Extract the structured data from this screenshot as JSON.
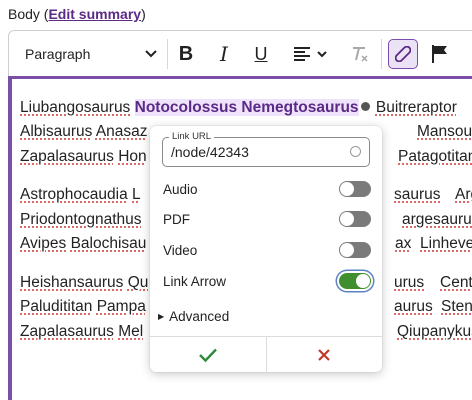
{
  "field": {
    "label": "Body (",
    "link": "Edit summary",
    "close": ")"
  },
  "toolbar": {
    "format_value": "Paragraph",
    "icons": [
      "chevron-down-icon",
      "bold-icon",
      "italic-icon",
      "underline-icon",
      "align-icon",
      "remove-format-icon",
      "link-icon",
      "flag-icon"
    ]
  },
  "editor": {
    "lines": [
      [
        "Liubangosaurus",
        "Notocolossus Nemegtosaurus",
        "Buitreraptor"
      ],
      [
        "Albisaurus",
        "Anasaz",
        "Mansourasa"
      ],
      [
        "Zapalasaurus",
        "Hon",
        "Patagotitan S"
      ],
      [
        "Astrophocaudia",
        "L",
        "saurus",
        "Argyr"
      ],
      [
        "Priodontognathus",
        "argesaurus"
      ],
      [
        "Avipes",
        "Balochisau",
        "ax",
        "Linheven"
      ],
      [
        "Heishansaurus",
        "Qu",
        "urus",
        "Centem"
      ],
      [
        "Paludititan",
        "Pampa",
        "aurus",
        "Steno"
      ],
      [
        "Zapalasaurus",
        "Mel",
        "Qiupanykus"
      ]
    ]
  },
  "popup": {
    "url_label": "Link URL",
    "url_value": "/node/42343",
    "options": [
      {
        "label": "Audio",
        "on": false
      },
      {
        "label": "PDF",
        "on": false
      },
      {
        "label": "Video",
        "on": false
      },
      {
        "label": "Link Arrow",
        "on": true
      }
    ],
    "advanced": "Advanced",
    "ok_icon": "check-icon",
    "cancel_icon": "close-icon"
  },
  "colors": {
    "accent": "#7b4fa6",
    "link": "#5b2a86",
    "toggle_on": "#3f8f2f",
    "check": "#2e8b3a",
    "cancel": "#c0392b"
  }
}
